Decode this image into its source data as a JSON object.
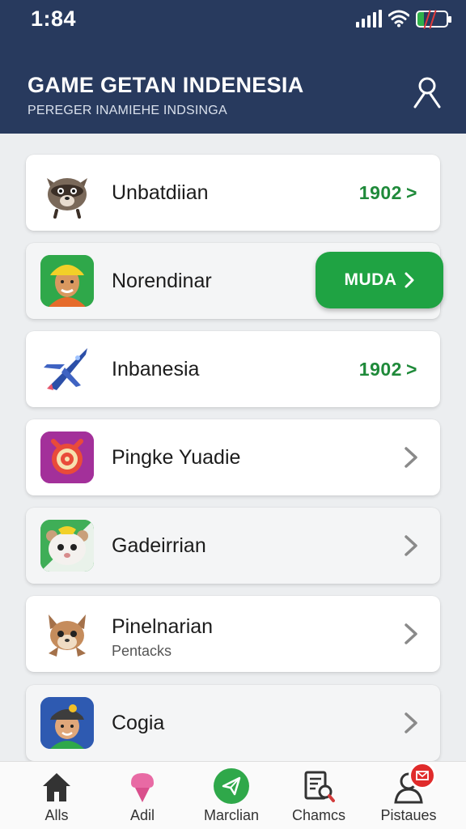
{
  "status_bar": {
    "time": "1:84"
  },
  "header": {
    "title": "GAME GETAN INDENESIA",
    "subtitle": "PEREGER INAMIEHE INDSINGA"
  },
  "games": [
    {
      "title": "Unbatdiian",
      "value": "1902",
      "thumb": "raccoon-icon"
    },
    {
      "title": "Norendinar",
      "action_label": "MUDA",
      "thumb": "man-hardhat-icon"
    },
    {
      "title": "Inbanesia",
      "value": "1902",
      "thumb": "jet-fighter-icon"
    },
    {
      "title": "Pingke Yuadie",
      "thumb": "target-icon"
    },
    {
      "title": "Gadeirrian",
      "thumb": "hamster-icon"
    },
    {
      "title": "Pinelnarian",
      "subtitle": "Pentacks",
      "thumb": "squirrel-icon"
    },
    {
      "title": "Cogia",
      "thumb": "boy-cap-icon"
    }
  ],
  "colors": {
    "header": "#283a5e",
    "accent": "#1fa343",
    "value": "#1f8a3a"
  },
  "nav": [
    {
      "label": "Alls",
      "icon": "home-icon"
    },
    {
      "label": "Adil",
      "icon": "ice-cream-icon"
    },
    {
      "label": "Marclian",
      "icon": "paper-plane-icon"
    },
    {
      "label": "Chamcs",
      "icon": "document-search-icon"
    },
    {
      "label": "Pistaues",
      "icon": "profile-icon"
    }
  ]
}
